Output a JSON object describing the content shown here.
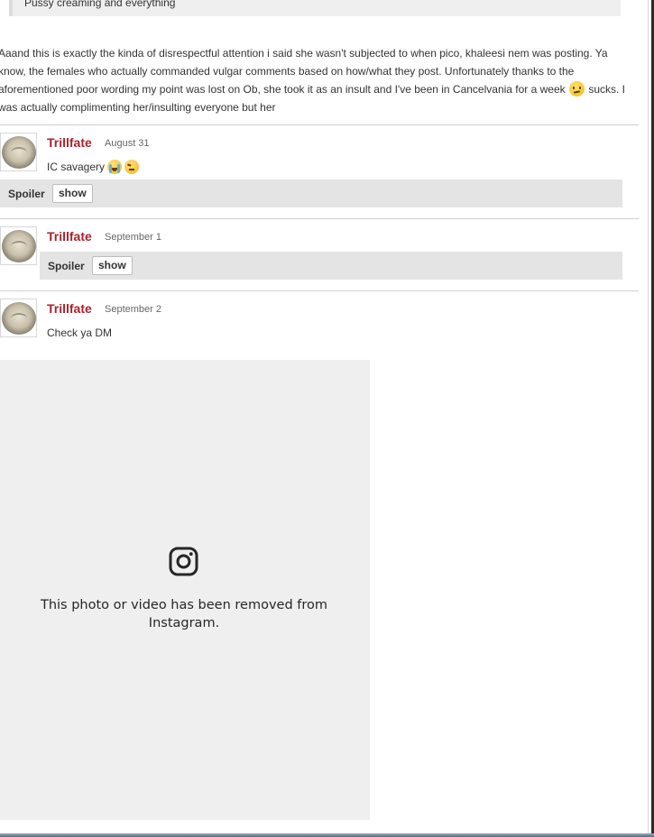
{
  "quote": {
    "text": "Pussy creaming and everything"
  },
  "post": {
    "text_before_emoji": "Aaand this is exactly the kinda of disrespectful attention i said she wasn't subjected to when pico, khaleesi nem was posting. Ya know, the females who actually commanded vulgar comments based on how/what they post. Unfortunately thanks to the aforementioned poor wording my point was lost on Ob, she took it as an insult and I've been in Cancelvania for a week",
    "emoji": "confused-face-emoji",
    "text_after_emoji": "sucks. I was actually complimenting her/insulting everyone but her"
  },
  "comments": [
    {
      "username": "Trillfate",
      "date": "August 31",
      "text": "IC savagery",
      "emojis": [
        "crying-face-emoji",
        "tired-face-emoji"
      ],
      "spoiler": {
        "label": "Spoiler",
        "button": "show"
      }
    },
    {
      "username": "Trillfate",
      "date": "September 1",
      "text": "",
      "spoiler": {
        "label": "Spoiler",
        "button": "show"
      }
    },
    {
      "username": "Trillfate",
      "date": "September 2",
      "text": "Check ya DM"
    }
  ],
  "embed": {
    "icon": "instagram-icon",
    "message": "This photo or video has been removed from Instagram."
  },
  "colors": {
    "username": "#a8222c",
    "spoiler_bg": "#e4e4e4",
    "embed_bg": "#efefef"
  }
}
